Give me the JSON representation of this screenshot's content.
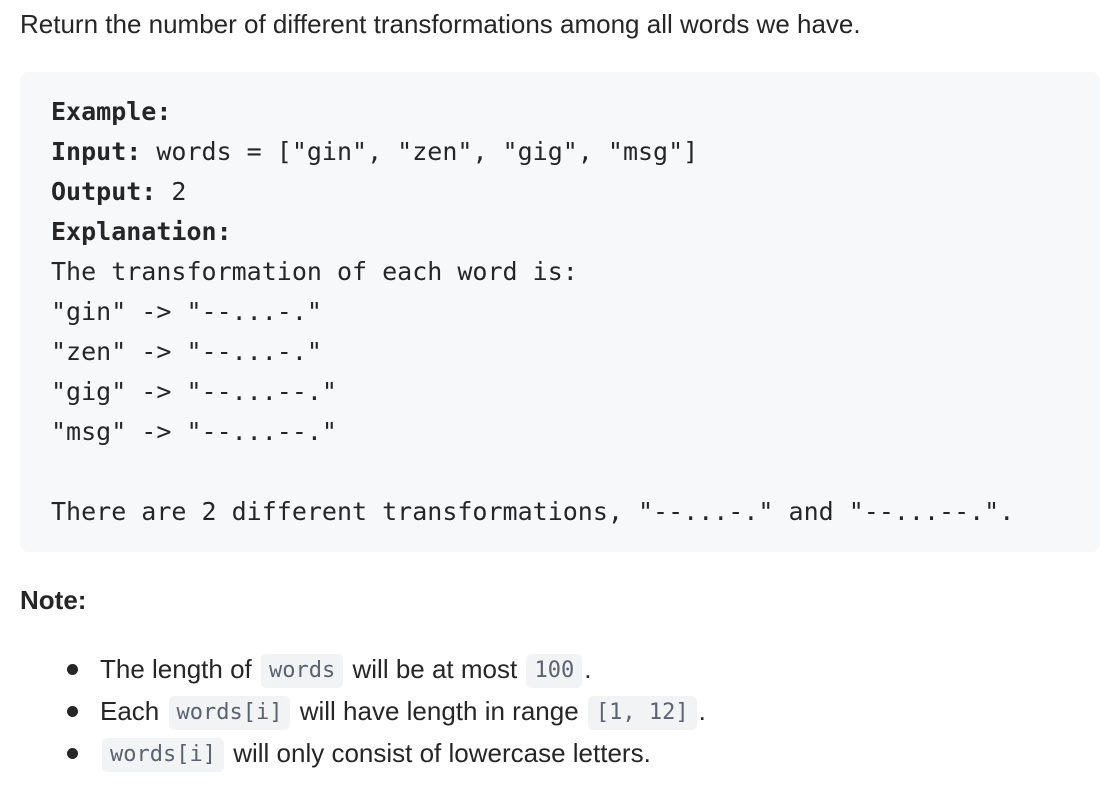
{
  "intro": "Return the number of different transformations among all words we have.",
  "example": {
    "heading": "Example:",
    "input_label": "Input:",
    "input_value": " words = [\"gin\", \"zen\", \"gig\", \"msg\"]",
    "output_label": "Output:",
    "output_value": " 2",
    "explanation_label": "Explanation:",
    "explanation_lines": [
      "The transformation of each word is:",
      "\"gin\" -> \"--...-.\"",
      "\"zen\" -> \"--...-.\"",
      "\"gig\" -> \"--...--.\"",
      "\"msg\" -> \"--...--.\""
    ],
    "conclusion": "There are 2 different transformations, \"--...-.\" and \"--...--.\"."
  },
  "note": {
    "heading": "Note:",
    "items": [
      {
        "t1": "The length of",
        "c1": "words",
        "t2": "will be at most",
        "c2": "100",
        "t3": "."
      },
      {
        "t1": "Each",
        "c1": "words[i]",
        "t2": "will have length in range",
        "c2": "[1, 12]",
        "t3": "."
      },
      {
        "c1": "words[i]",
        "t2": "will only consist of lowercase letters."
      }
    ]
  }
}
